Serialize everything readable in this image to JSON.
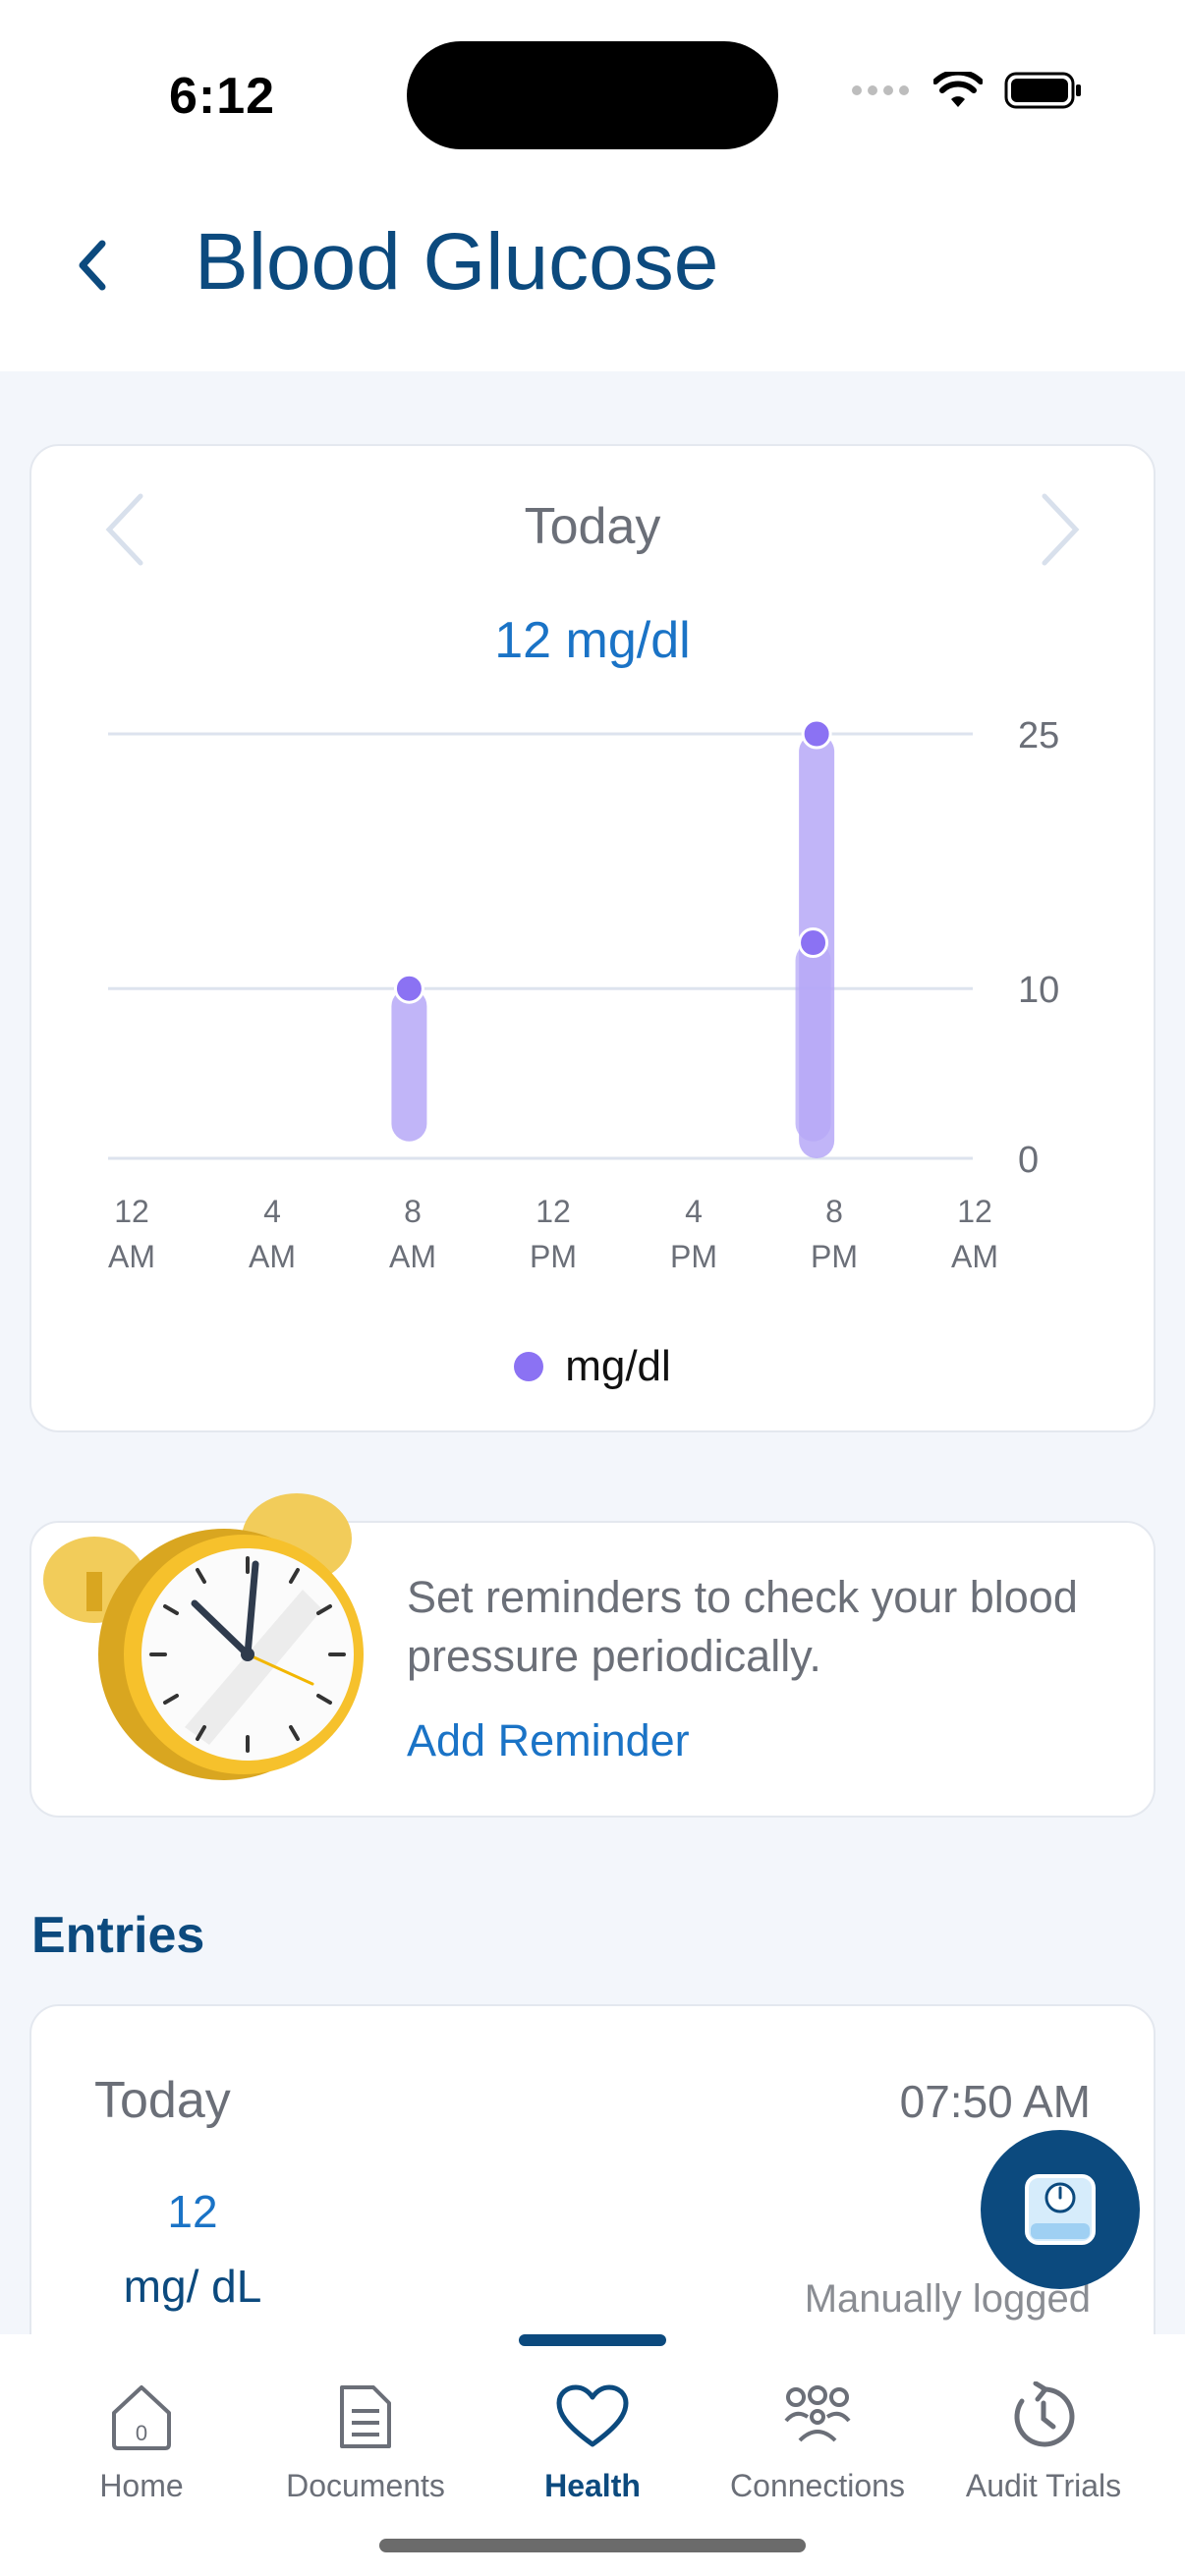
{
  "status_bar": {
    "time": "6:12"
  },
  "header": {
    "title": "Blood Glucose"
  },
  "chart_card": {
    "period": "Today",
    "current_value": "12 mg/dl"
  },
  "chart_data": {
    "type": "bar",
    "description_free": true,
    "x_tick_labels": [
      [
        "12",
        "AM"
      ],
      [
        "4",
        "AM"
      ],
      [
        "8",
        "AM"
      ],
      [
        "12",
        "PM"
      ],
      [
        "4",
        "PM"
      ],
      [
        "8",
        "PM"
      ],
      [
        "12",
        "AM"
      ]
    ],
    "y_ticks": [
      0,
      10,
      25
    ],
    "ylim": [
      0,
      25
    ],
    "xlim_hours": [
      0,
      24
    ],
    "series": [
      {
        "name": "mg/dl",
        "points": [
          {
            "hour": 7.9,
            "low": 1,
            "high": 10
          },
          {
            "hour": 19.5,
            "low": 0,
            "high": 25
          },
          {
            "hour": 19.4,
            "low": 1,
            "high": 12.7
          }
        ]
      }
    ],
    "legend": "bottom",
    "grid": true,
    "colors": {
      "bar": "#b6a8f7",
      "dot": "#8b72f3",
      "grid": "#dde3ee"
    }
  },
  "reminder": {
    "text": "Set reminders to check your blood pressure periodically.",
    "link": "Add Reminder"
  },
  "entries": {
    "title": "Entries",
    "items": [
      {
        "date": "Today",
        "time": "07:50 AM",
        "value": "12",
        "unit": "mg/ dL",
        "source": "Manually logged"
      }
    ]
  },
  "tabs": [
    {
      "label": "Home",
      "icon": "home-icon",
      "active": false
    },
    {
      "label": "Documents",
      "icon": "document-icon",
      "active": false
    },
    {
      "label": "Health",
      "icon": "heart-icon",
      "active": true
    },
    {
      "label": "Connections",
      "icon": "connections-icon",
      "active": false
    },
    {
      "label": "Audit Trials",
      "icon": "history-icon",
      "active": false
    }
  ],
  "colors": {
    "primary": "#0c4a7e",
    "link": "#1a73c6",
    "background": "#f3f6fb"
  }
}
